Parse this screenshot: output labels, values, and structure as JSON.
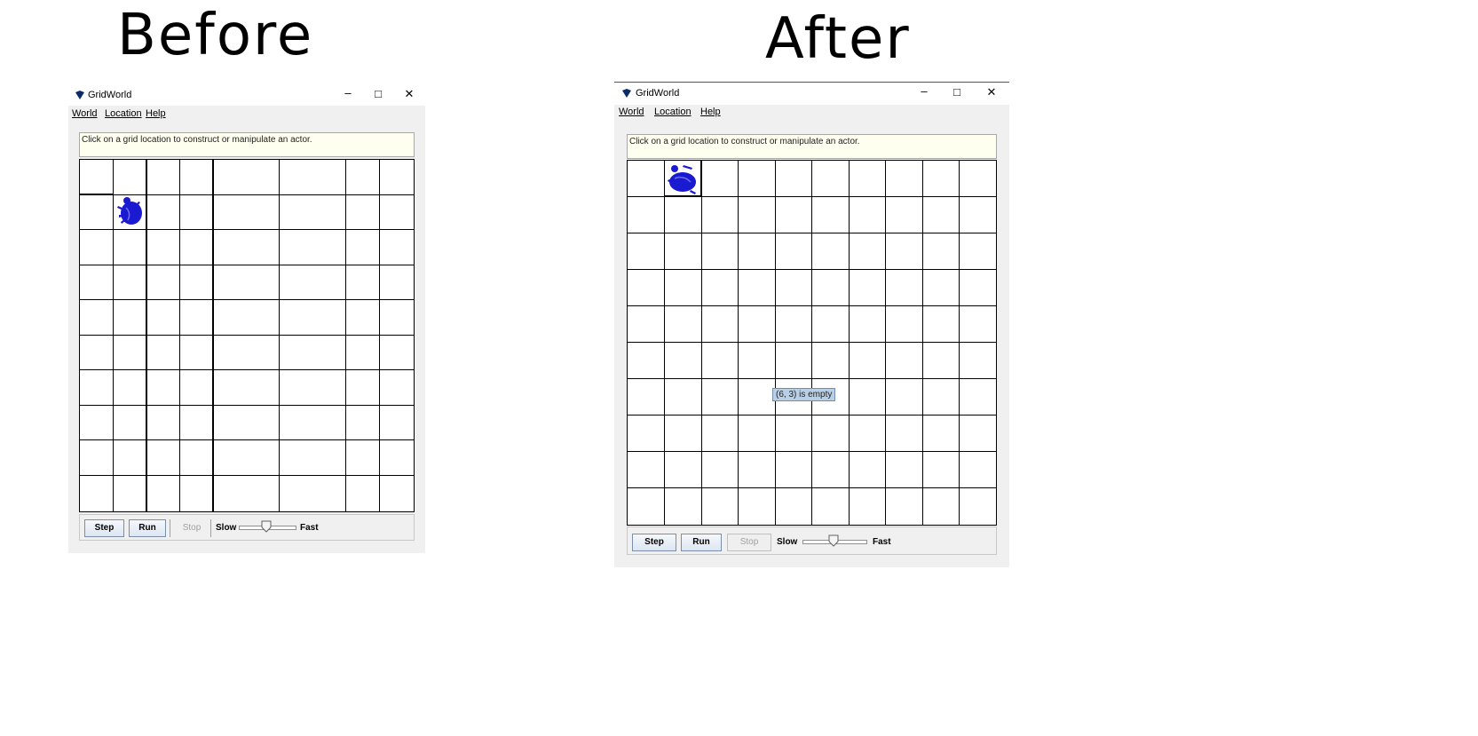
{
  "headings": {
    "before": "Before",
    "after": "After"
  },
  "windows": [
    {
      "id": "before",
      "title": "GridWorld",
      "menu": [
        "World",
        "Location",
        "Help"
      ],
      "message": "Click on a grid location to construct or manipulate an actor.",
      "grid": {
        "rows": 10,
        "cols": 8
      },
      "actor": {
        "row": 1,
        "col": 1,
        "icon": "bug-icon",
        "color": "#1a1ad0"
      },
      "controls": {
        "step": "Step",
        "run": "Run",
        "stop": "Stop",
        "slow": "Slow",
        "fast": "Fast"
      },
      "speed": 0.45
    },
    {
      "id": "after",
      "title": "GridWorld",
      "menu": [
        "World",
        "Location",
        "Help"
      ],
      "message": "Click on a grid location to construct or manipulate an actor.",
      "grid": {
        "rows": 10,
        "cols": 10
      },
      "actor": {
        "row": 0,
        "col": 1,
        "icon": "bug-icon",
        "color": "#1a1ad0"
      },
      "tooltip": "(6, 3) is empty",
      "controls": {
        "step": "Step",
        "run": "Run",
        "stop": "Stop",
        "slow": "Slow",
        "fast": "Fast"
      },
      "speed": 0.45
    }
  ]
}
